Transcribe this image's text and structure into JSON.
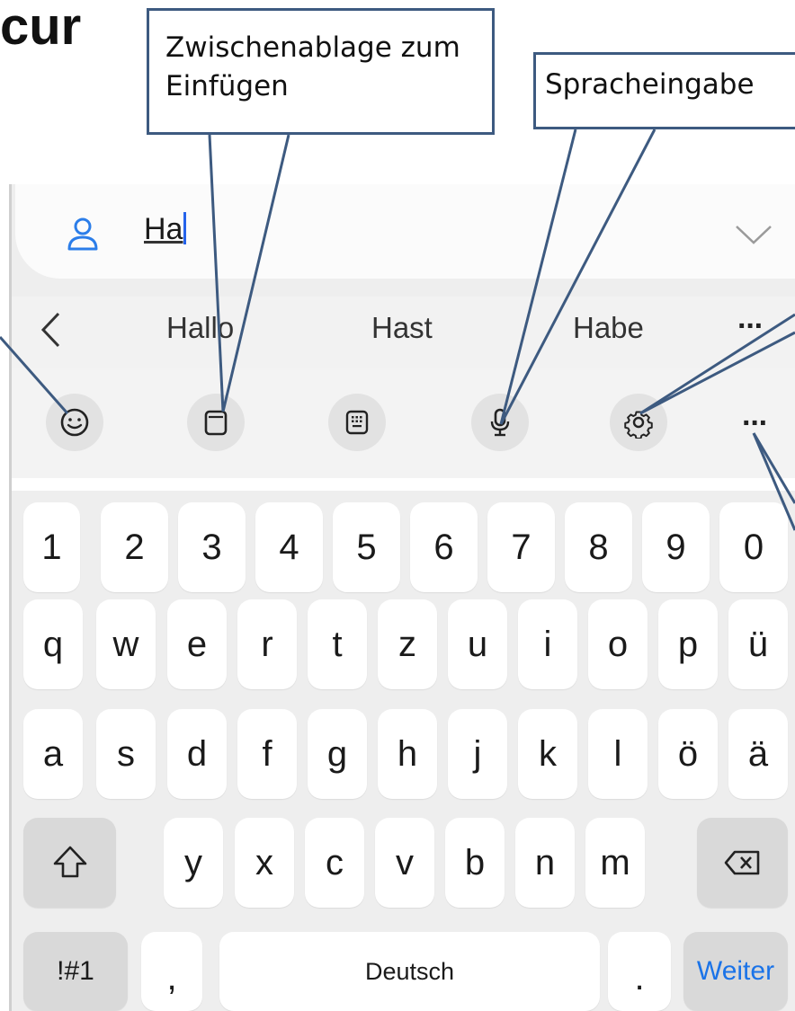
{
  "slide": {
    "title_fragment": "cur",
    "callouts": [
      {
        "text": "Zwischenablage zum Einfügen"
      },
      {
        "text": "Spracheingabe"
      }
    ]
  },
  "address_field": {
    "value": "Ha",
    "icon": "person-icon",
    "dropdown_icon": "chevron-down-icon"
  },
  "suggestions": {
    "items": [
      "Hallo",
      "Hast",
      "Habe"
    ],
    "back_icon": "chevron-left-icon",
    "more": "···"
  },
  "toolbar": {
    "buttons": [
      "emoji-icon",
      "clipboard-icon",
      "keyboard-mode-icon",
      "microphone-icon",
      "gear-icon"
    ],
    "more": "···"
  },
  "keyboard": {
    "numbers": [
      "1",
      "2",
      "3",
      "4",
      "5",
      "6",
      "7",
      "8",
      "9",
      "0"
    ],
    "row1": [
      "q",
      "w",
      "e",
      "r",
      "t",
      "z",
      "u",
      "i",
      "o",
      "p",
      "ü"
    ],
    "row2": [
      "a",
      "s",
      "d",
      "f",
      "g",
      "h",
      "j",
      "k",
      "l",
      "ö",
      "ä"
    ],
    "row3": [
      "y",
      "x",
      "c",
      "v",
      "b",
      "n",
      "m"
    ],
    "shift_icon": "shift-icon",
    "backspace_icon": "backspace-icon",
    "symbols": "!#1",
    "comma": ",",
    "space": "Deutsch",
    "period": ".",
    "enter": "Weiter"
  },
  "colors": {
    "callout_border": "#3d5a80",
    "accent": "#1a73e8",
    "caret": "#2563eb"
  }
}
